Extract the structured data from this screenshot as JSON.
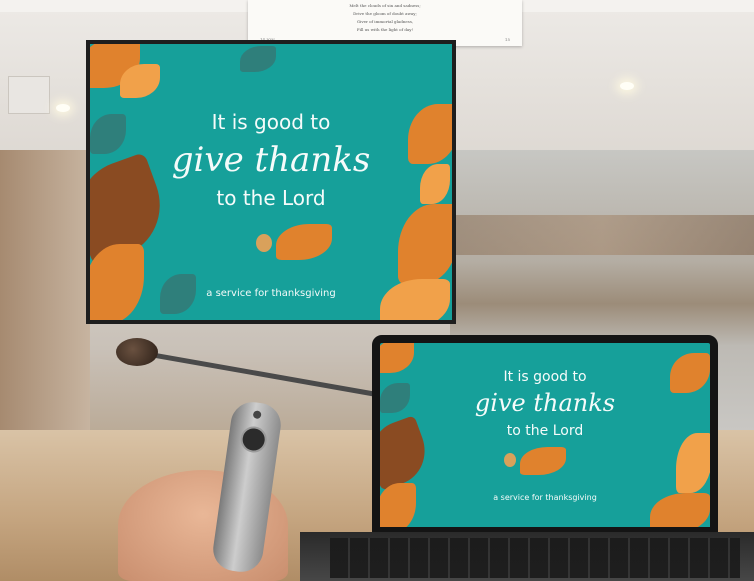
{
  "document_clipping": {
    "lines": [
      "Melt the clouds of sin and sadness;",
      "Drive the gloom of doubt away;",
      "Giver of immortal gladness,",
      "Fill us with the light of day!"
    ],
    "footer_left": "14 ION",
    "footer_right": "15"
  },
  "slide": {
    "line1": "It is good to",
    "line2": "give thanks",
    "line3": "to the Lord",
    "subtitle": "a service for thanksgiving",
    "background_color": "#16a09a",
    "leaf_colors": [
      "#e0822d",
      "#8a4b22",
      "#2f7f7b",
      "#f1a14a"
    ]
  }
}
